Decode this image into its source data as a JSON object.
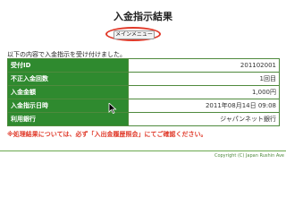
{
  "header": {
    "title": "入金指示結果",
    "main_menu_button": "メインメニュー"
  },
  "intro_text": "以下の内容で入金指示を受け付けました。",
  "results_table": [
    {
      "label": "受付ID",
      "value": "201102001"
    },
    {
      "label": "不正入金回数",
      "value": "1回目"
    },
    {
      "label": "入金金額",
      "value": "1,000円"
    },
    {
      "label": "入金指示日時",
      "value": "2011年08月14日 09:08"
    },
    {
      "label": "利用銀行",
      "value": "ジャパンネット銀行"
    }
  ],
  "notice": "※処理結果については、必ず「入出金履歴照会」にてご確認ください。",
  "footer": {
    "copyright": "Copyright (C) Japan Rushin Ave"
  },
  "colors": {
    "label_bg": "#2f8a2f",
    "notice": "#e03a2a",
    "annotation_ring": "#e03a2a",
    "footer_line": "#6aa84f"
  }
}
